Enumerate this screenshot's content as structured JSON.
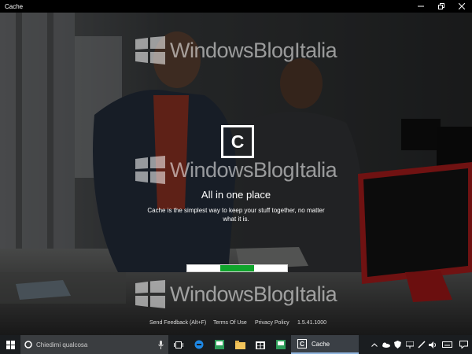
{
  "window": {
    "title": "Cache"
  },
  "app": {
    "logo_letter": "C",
    "headline": "All in one place",
    "description": "Cache is the simplest way to keep your stuff together, no matter what it is.",
    "progress": {
      "segments": 3,
      "active_segment": 2
    },
    "footer": {
      "feedback": "Send Feedback (Alt+F)",
      "terms": "Terms Of Use",
      "privacy": "Privacy Policy",
      "version": "1.5.41.1000"
    },
    "watermark": "WindowsBlogItalia"
  },
  "taskbar": {
    "search_placeholder": "Chiedimi qualcosa",
    "active_app_label": "Cache",
    "active_app_letter": "C"
  },
  "colors": {
    "progress_active": "#10a52c",
    "taskbar": "#1a1d20",
    "accent_underline": "#8fb4dd"
  }
}
